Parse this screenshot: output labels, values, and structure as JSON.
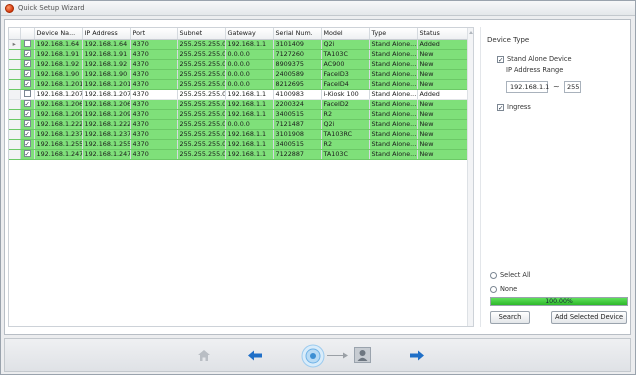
{
  "window": {
    "title": "Quick Setup Wizard"
  },
  "grid": {
    "columns": [
      "Device Na...",
      "IP Address",
      "Port",
      "Subnet",
      "Gateway",
      "Serial Num.",
      "Model",
      "Type",
      "Status"
    ],
    "rows": [
      {
        "checked": false,
        "current": true,
        "highlight": "green",
        "cells": [
          "192.168.1.64",
          "192.168.1.64",
          "4370",
          "255.255.255.0",
          "192.168.1.1",
          "3101409",
          "Q2i",
          "Stand Alone...",
          "Added"
        ]
      },
      {
        "checked": true,
        "current": false,
        "highlight": "green",
        "cells": [
          "192.168.1.91",
          "192.168.1.91",
          "4370",
          "255.255.255.0",
          "0.0.0.0",
          "7127260",
          "TA103C",
          "Stand Alone...",
          "New"
        ]
      },
      {
        "checked": true,
        "current": false,
        "highlight": "green",
        "cells": [
          "192.168.1.92",
          "192.168.1.92",
          "4370",
          "255.255.255.0",
          "0.0.0.0",
          "8909375",
          "AC900",
          "Stand Alone...",
          "New"
        ]
      },
      {
        "checked": true,
        "current": false,
        "highlight": "green",
        "cells": [
          "192.168.1.90",
          "192.168.1.90",
          "4370",
          "255.255.255.0",
          "0.0.0.0",
          "2400589",
          "FaceID3",
          "Stand Alone...",
          "New"
        ]
      },
      {
        "checked": true,
        "current": false,
        "highlight": "green",
        "cells": [
          "192.168.1.201",
          "192.168.1.201",
          "4370",
          "255.255.255.0",
          "0.0.0.0",
          "8212695",
          "FaceID4",
          "Stand Alone...",
          "New"
        ]
      },
      {
        "checked": false,
        "current": false,
        "highlight": "white",
        "cells": [
          "192.168.1.207",
          "192.168.1.207",
          "4370",
          "255.255.255.0",
          "192.168.1.1",
          "4100983",
          "i-Kiosk 100",
          "Stand Alone...",
          "Added"
        ]
      },
      {
        "checked": true,
        "current": false,
        "highlight": "green",
        "cells": [
          "192.168.1.206",
          "192.168.1.206",
          "4370",
          "255.255.255.0",
          "192.168.1.1",
          "2200324",
          "FaceID2",
          "Stand Alone...",
          "New"
        ]
      },
      {
        "checked": true,
        "current": false,
        "highlight": "green",
        "cells": [
          "192.168.1.209",
          "192.168.1.209",
          "4370",
          "255.255.255.0",
          "192.168.1.1",
          "3400515",
          "R2",
          "Stand Alone...",
          "New"
        ]
      },
      {
        "checked": true,
        "current": false,
        "highlight": "green",
        "cells": [
          "192.168.1.222",
          "192.168.1.222",
          "4370",
          "255.255.255.0",
          "0.0.0.0",
          "7121487",
          "Q2i",
          "Stand Alone...",
          "New"
        ]
      },
      {
        "checked": true,
        "current": false,
        "highlight": "green",
        "cells": [
          "192.168.1.237",
          "192.168.1.237",
          "4370",
          "255.255.255.0",
          "192.168.1.1",
          "3101908",
          "TA103RC",
          "Stand Alone...",
          "New"
        ]
      },
      {
        "checked": true,
        "current": false,
        "highlight": "green",
        "cells": [
          "192.168.1.255",
          "192.168.1.255",
          "4370",
          "255.255.255.0",
          "192.168.1.1",
          "3400515",
          "R2",
          "Stand Alone...",
          "New"
        ]
      },
      {
        "checked": true,
        "current": false,
        "highlight": "green",
        "cells": [
          "192.168.1.247",
          "192.168.1.247",
          "4370",
          "255.255.255.0",
          "192.168.1.1",
          "7122887",
          "TA103C",
          "Stand Alone...",
          "New"
        ]
      }
    ]
  },
  "panel": {
    "title": "Device Type",
    "stand_alone_label": "Stand Alone Device",
    "stand_alone_checked": true,
    "ip_range_label": "IP Address Range",
    "ip_start": "192.168.1.1",
    "ip_end": "255",
    "ingress_label": "Ingress",
    "ingress_checked": true,
    "select_all_label": "Select All",
    "none_label": "None",
    "progress_text": "100.00%",
    "progress_value": 1.0,
    "search_label": "Search",
    "add_label": "Add Selected Device"
  },
  "toolbar": {
    "icons": [
      "home-icon",
      "back-arrow-icon",
      "scan-device-icon",
      "connector-icon",
      "user-upload-icon",
      "forward-arrow-icon"
    ]
  },
  "colors": {
    "row_green": "#7fe07a",
    "progress_green": "#2eb82a",
    "arrow_blue": "#1f6fc7"
  }
}
